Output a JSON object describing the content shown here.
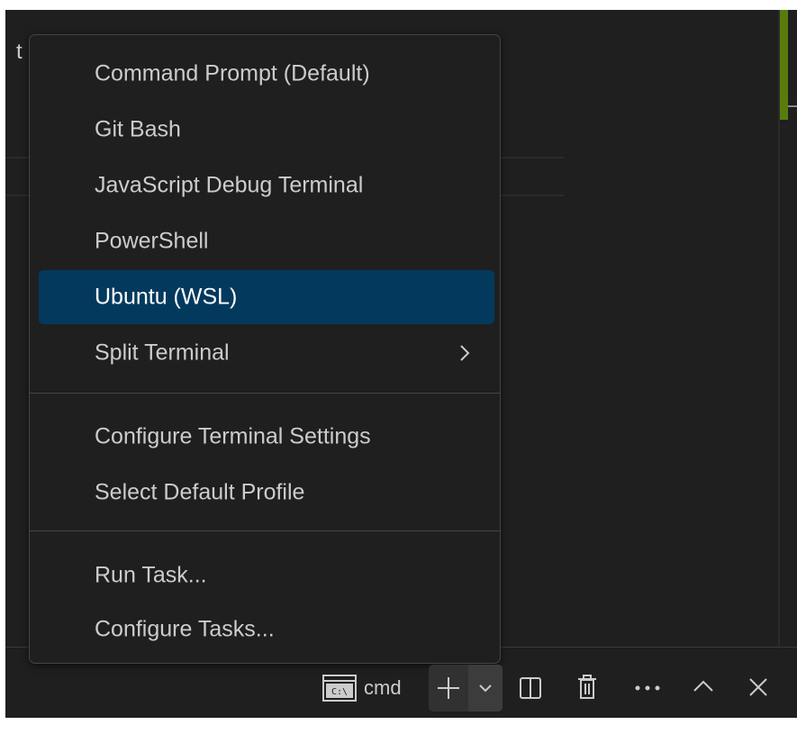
{
  "editor": {
    "partial_text": "t"
  },
  "menu": {
    "groups": [
      {
        "items": [
          {
            "label": "Command Prompt (Default)"
          },
          {
            "label": "Git Bash"
          },
          {
            "label": "JavaScript Debug Terminal"
          },
          {
            "label": "PowerShell"
          },
          {
            "label": "Ubuntu (WSL)",
            "selected": true
          },
          {
            "label": "Split Terminal",
            "has_submenu": true
          }
        ]
      },
      {
        "items": [
          {
            "label": "Configure Terminal Settings"
          },
          {
            "label": "Select Default Profile"
          }
        ]
      },
      {
        "items": [
          {
            "label": "Run Task..."
          },
          {
            "label": "Configure Tasks..."
          }
        ]
      }
    ]
  },
  "toolbar": {
    "terminal_name": "cmd",
    "terminal_icon": "cmd-icon",
    "new_terminal_icon": "plus-icon",
    "profile_dropdown_icon": "chevron-down-icon",
    "split_icon": "split-editor-icon",
    "kill_icon": "trash-icon",
    "more_icon": "ellipsis-icon",
    "maximize_icon": "chevron-up-icon",
    "close_icon": "close-icon"
  },
  "colors": {
    "background": "#1f1f1f",
    "selection": "#04395e",
    "menu_border": "#454545",
    "text": "#cccccc",
    "scrollbar_accent": "#587c0c"
  }
}
